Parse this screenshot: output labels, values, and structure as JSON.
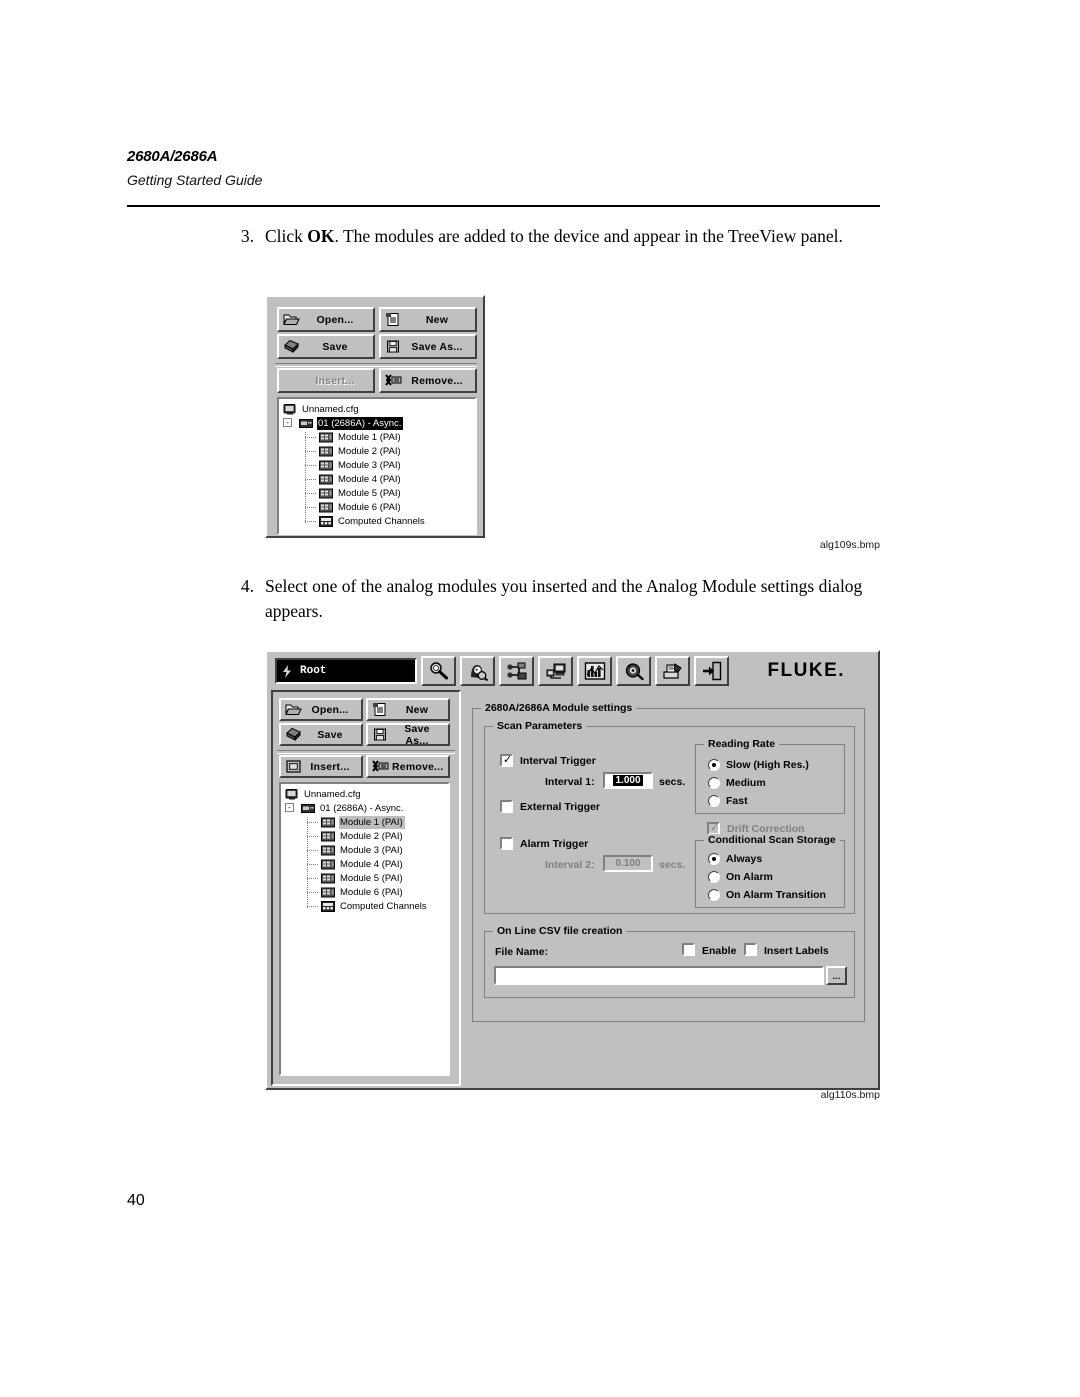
{
  "page": {
    "model": "2680A/2686A",
    "guide": "Getting Started Guide",
    "number": "40"
  },
  "steps": [
    {
      "num": "3.",
      "text_before": "Click ",
      "bold": "OK",
      "text_after": ". The modules are added to the device and appear in the TreeView panel."
    },
    {
      "num": "4.",
      "text": "Select one of the analog modules you inserted and the Analog Module settings dialog appears."
    }
  ],
  "figure1": {
    "caption": "alg109s.bmp",
    "toolbar": [
      {
        "label": "Open...",
        "icon": "folder-open-icon",
        "disabled": false
      },
      {
        "label": "New",
        "icon": "new-document-icon",
        "disabled": false
      },
      {
        "label": "Save",
        "icon": "floppy-disk-icon",
        "disabled": false
      },
      {
        "label": "Save As...",
        "icon": "save-as-icon",
        "disabled": false
      },
      {
        "label": "Insert...",
        "icon": "insert-module-icon",
        "disabled": true
      },
      {
        "label": "Remove...",
        "icon": "remove-module-icon",
        "disabled": false
      }
    ],
    "tree": {
      "root": {
        "label": "Unnamed.cfg",
        "icon": "computer-icon"
      },
      "instrument": {
        "label": "01 (2686A) - Async.",
        "icon": "instrument-icon",
        "selected": true,
        "expander": "-"
      },
      "children": [
        {
          "label": "Module 1 (PAI)",
          "icon": "module-icon"
        },
        {
          "label": "Module 2 (PAI)",
          "icon": "module-icon"
        },
        {
          "label": "Module 3 (PAI)",
          "icon": "module-icon"
        },
        {
          "label": "Module 4 (PAI)",
          "icon": "module-icon"
        },
        {
          "label": "Module 5 (PAI)",
          "icon": "module-icon"
        },
        {
          "label": "Module 6 (PAI)",
          "icon": "module-icon"
        },
        {
          "label": "Computed Channels",
          "icon": "computed-channels-icon"
        }
      ]
    }
  },
  "figure2": {
    "caption": "alg110s.bmp",
    "header": {
      "root_field": "Root",
      "root_icon": "lightning-icon",
      "brand": "FLUKE",
      "brand_dot": ".",
      "icons": [
        "inspect-probe-icon",
        "operator-setup-icon",
        "wiring-config-icon",
        "network-computer-icon",
        "trend-chart-icon",
        "alarm-bell-icon",
        "printer-report-icon",
        "exit-door-icon"
      ]
    },
    "toolbar": [
      {
        "label": "Open...",
        "icon": "folder-open-icon",
        "disabled": false
      },
      {
        "label": "New",
        "icon": "new-document-icon",
        "disabled": false
      },
      {
        "label": "Save",
        "icon": "floppy-disk-icon",
        "disabled": false
      },
      {
        "label": "Save As...",
        "icon": "save-as-icon",
        "disabled": false
      },
      {
        "label": "Insert...",
        "icon": "insert-module-icon",
        "disabled": false
      },
      {
        "label": "Remove...",
        "icon": "remove-module-icon",
        "disabled": false
      }
    ],
    "tree": {
      "root": {
        "label": "Unnamed.cfg",
        "icon": "computer-icon"
      },
      "instrument": {
        "label": "01 (2686A) - Async.",
        "icon": "instrument-icon",
        "expander": "-"
      },
      "children": [
        {
          "label": "Module 1 (PAI)",
          "icon": "module-icon",
          "selected": true
        },
        {
          "label": "Module 2 (PAI)",
          "icon": "module-icon"
        },
        {
          "label": "Module 3 (PAI)",
          "icon": "module-icon"
        },
        {
          "label": "Module 4 (PAI)",
          "icon": "module-icon"
        },
        {
          "label": "Module 5 (PAI)",
          "icon": "module-icon"
        },
        {
          "label": "Module 6 (PAI)",
          "icon": "module-icon"
        },
        {
          "label": "Computed Channels",
          "icon": "computed-channels-icon"
        }
      ]
    },
    "dialog": {
      "title": "2680A/2686A Module settings",
      "scan_parameters": {
        "title": "Scan Parameters",
        "interval_trigger": {
          "label": "Interval Trigger",
          "checked": true
        },
        "interval1": {
          "label": "Interval 1:",
          "value": "1.000",
          "units": "secs.",
          "disabled": false
        },
        "external_trigger": {
          "label": "External Trigger",
          "checked": false
        },
        "alarm_trigger": {
          "label": "Alarm Trigger",
          "checked": false
        },
        "interval2": {
          "label": "Interval 2:",
          "value": "0.100",
          "units": "secs.",
          "disabled": true
        },
        "reading_rate": {
          "title": "Reading Rate",
          "options": [
            "Slow (High Res.)",
            "Medium",
            "Fast"
          ],
          "selected": "Slow (High Res.)"
        },
        "drift_correction": {
          "label": "Drift Correction",
          "checked": true,
          "disabled": true
        },
        "conditional_scan_storage": {
          "title": "Conditional Scan Storage",
          "options": [
            "Always",
            "On Alarm",
            "On Alarm Transition"
          ],
          "selected": "Always"
        }
      },
      "csv": {
        "title": "On Line CSV file creation",
        "file_name_label": "File Name:",
        "file_name_value": "",
        "enable": {
          "label": "Enable",
          "checked": false
        },
        "insert_labels": {
          "label": "Insert Labels",
          "checked": false
        },
        "browse_button": "..."
      }
    }
  },
  "colors": {
    "face": "#c0c0c0",
    "shadow": "#404040",
    "light": "#ffffff",
    "gray_text": "#808080",
    "selection": "#000000"
  }
}
